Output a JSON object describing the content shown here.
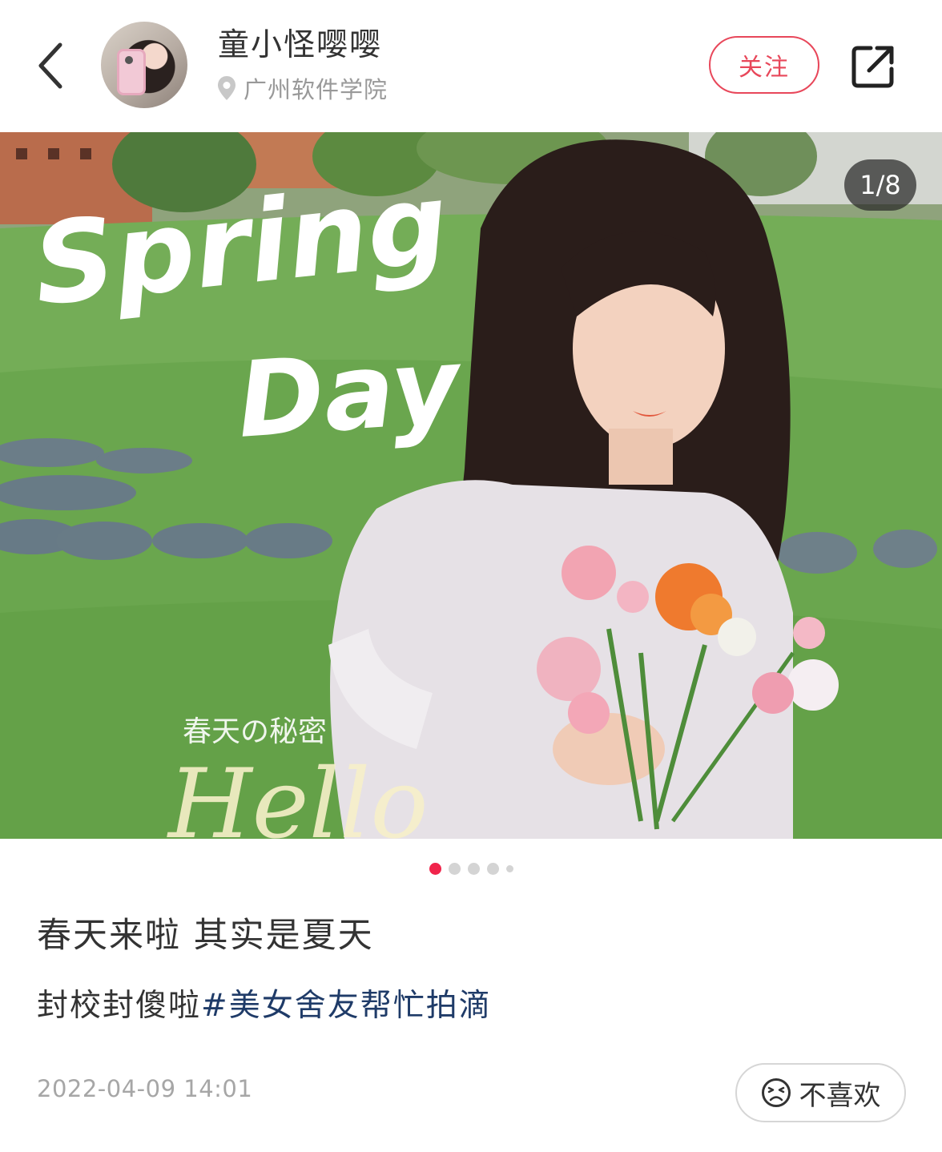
{
  "header": {
    "username": "童小怪嘤嘤",
    "location": "广州软件学院",
    "follow_label": "关注"
  },
  "photo": {
    "counter": "1/8",
    "overlay_title_line1": "Spring",
    "overlay_title_line2": "Day",
    "overlay_caption": "春天の秘密",
    "overlay_hello": "Hello"
  },
  "pager": {
    "total_dots_visible": 5,
    "active_index": 0
  },
  "post": {
    "title": "春天来啦 其实是夏天",
    "body_text": "封校封傻啦",
    "hashtag": "#美女舍友帮忙拍滴",
    "timestamp": "2022-04-09 14:01",
    "dislike_label": "不喜欢"
  },
  "colors": {
    "accent_red": "#e8475a",
    "dot_active": "#f0244b",
    "hashtag_blue": "#1f3b68"
  },
  "icons": {
    "back": "chevron-left-icon",
    "location": "location-pin-icon",
    "share": "share-icon",
    "dislike": "frown-face-icon"
  }
}
